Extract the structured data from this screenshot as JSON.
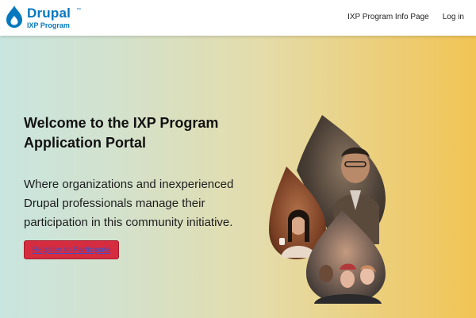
{
  "header": {
    "logo": {
      "word": "Drupal",
      "tm": "™",
      "subtitle": "IXP Program"
    },
    "nav": [
      {
        "label": "IXP Program Info Page"
      },
      {
        "label": "Log in"
      }
    ]
  },
  "hero": {
    "title": "Welcome to the IXP Program Application Portal",
    "text": "Where organizations and inexperienced Drupal professionals manage their participation in this community initiative.",
    "button_label": "Register to Participate"
  },
  "colors": {
    "brand_blue": "#0678be",
    "button_red": "#d62c3f",
    "gradient_start": "#c9e5df",
    "gradient_end": "#f2c454"
  },
  "icons": [
    "drupal-drop-icon"
  ]
}
